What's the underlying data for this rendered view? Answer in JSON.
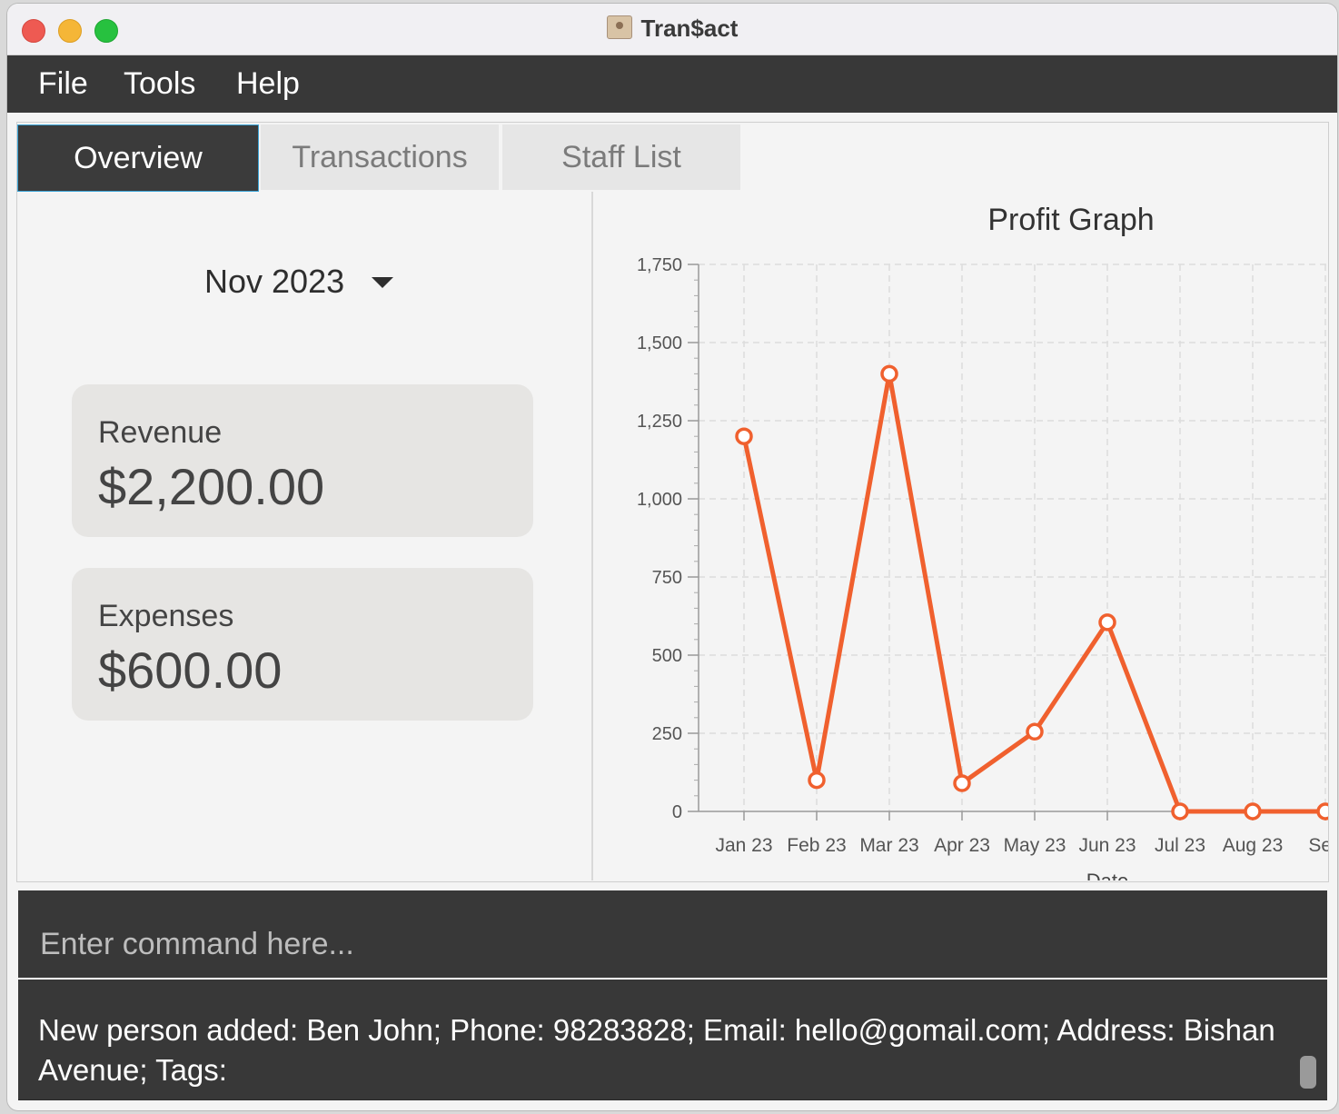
{
  "window": {
    "title": "Tran$act"
  },
  "menu": {
    "items": [
      "File",
      "Tools",
      "Help"
    ]
  },
  "tabs": [
    "Overview",
    "Transactions",
    "Staff List"
  ],
  "overview": {
    "month": "Nov 2023",
    "revenue_label": "Revenue",
    "revenue_value": "$2,200.00",
    "expenses_label": "Expenses",
    "expenses_value": "$600.00"
  },
  "command": {
    "placeholder": "Enter command here..."
  },
  "result": {
    "text": "New person added: Ben John; Phone: 98283828; Email: hello@gomail.com; Address: Bishan Avenue; Tags:"
  },
  "colors": {
    "accent": "#f0602e",
    "dark": "#383838"
  },
  "chart_data": {
    "type": "line",
    "title": "Profit Graph",
    "xlabel": "Date",
    "ylabel": "",
    "categories": [
      "Jan 23",
      "Feb 23",
      "Mar 23",
      "Apr 23",
      "May 23",
      "Jun 23",
      "Jul 23",
      "Aug 23",
      "Sep"
    ],
    "series": [
      {
        "values": [
          1200,
          100,
          1400,
          90,
          255,
          605,
          0,
          0,
          0
        ]
      }
    ],
    "ylim": [
      0,
      1750
    ],
    "yticks": [
      0,
      250,
      500,
      750,
      1000,
      1250,
      1500,
      1750
    ],
    "ytick_labels": [
      "0",
      "250",
      "500",
      "750",
      "1,000",
      "1,250",
      "1,500",
      "1,750"
    ],
    "grid": true
  }
}
